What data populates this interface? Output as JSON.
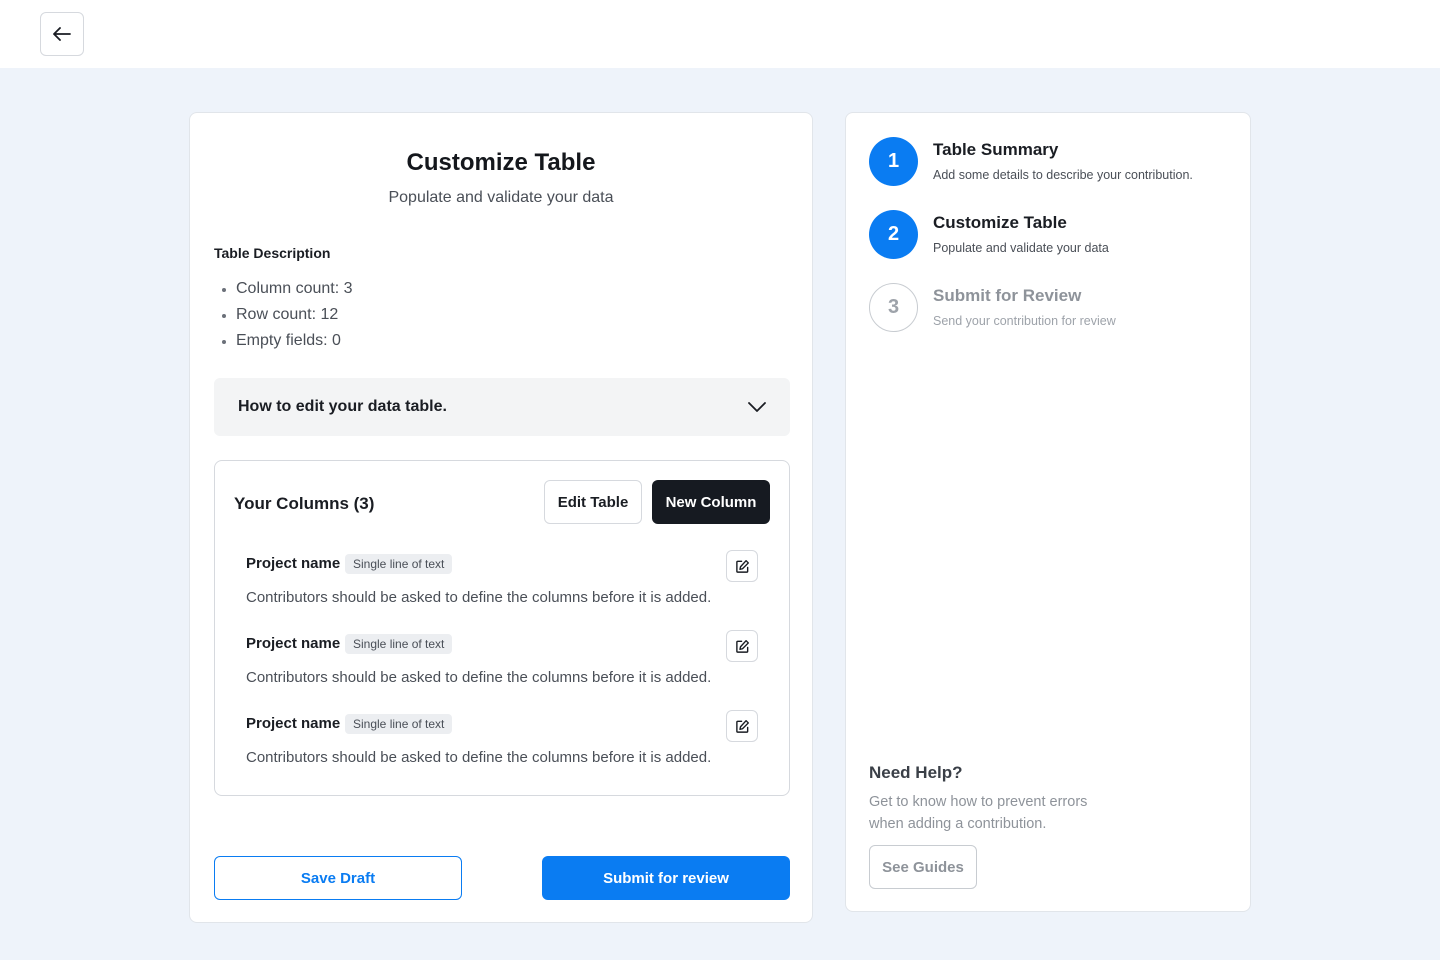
{
  "nav": {
    "back_icon": "arrow-left-icon"
  },
  "main": {
    "title": "Customize Table",
    "subtitle": "Populate and validate your data",
    "description_heading": "Table Description",
    "description_items": [
      "Column count: 3",
      "Row count: 12",
      "Empty fields: 0"
    ],
    "accordion": {
      "label": "How to edit your data table.",
      "icon": "chevron-down-icon",
      "expanded": false
    },
    "columns": {
      "title": "Your Columns (3)",
      "edit_label": "Edit Table",
      "new_label": "New Column",
      "items": [
        {
          "name": "Project name",
          "type": "Single line of text",
          "description": "Contributors should be asked to define the columns before it is added."
        },
        {
          "name": "Project name",
          "type": "Single line of text",
          "description": "Contributors should be asked to define the columns before it is added."
        },
        {
          "name": "Project name",
          "type": "Single line of text",
          "description": "Contributors should be asked to define the columns before it is added."
        }
      ]
    },
    "save_draft_label": "Save Draft",
    "submit_label": "Submit for review"
  },
  "steps": [
    {
      "number": "1",
      "title": "Table Summary",
      "subtitle": "Add some details to describe your contribution.",
      "state": "complete"
    },
    {
      "number": "2",
      "title": "Customize Table",
      "subtitle": "Populate and validate your data",
      "state": "current"
    },
    {
      "number": "3",
      "title": "Submit for Review",
      "subtitle": "Send your contribution for review",
      "state": "upcoming"
    }
  ],
  "help": {
    "title": "Need Help?",
    "text": "Get to know how to prevent errors when adding a contribution.",
    "button_label": "See Guides"
  },
  "colors": {
    "accent": "#0a7cf2",
    "dark_button": "#161a21",
    "background": "#eef3fa"
  }
}
